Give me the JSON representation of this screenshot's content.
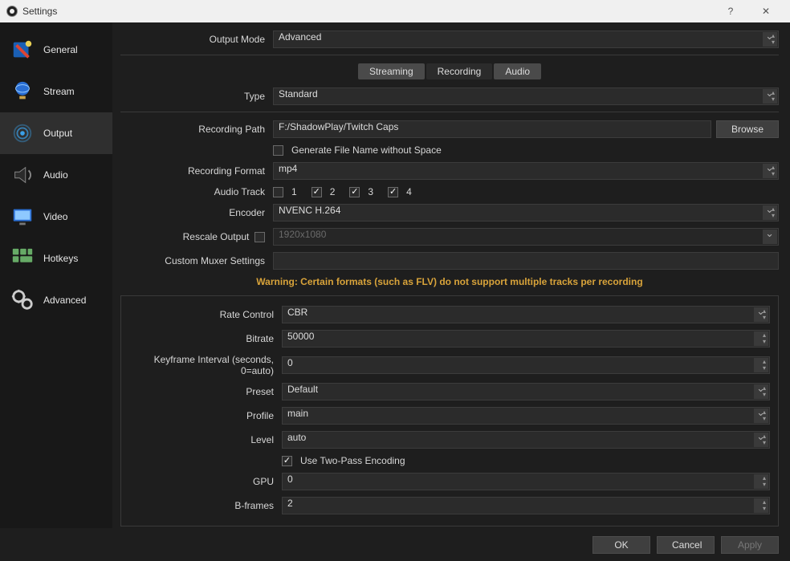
{
  "window": {
    "title": "Settings"
  },
  "sidebar": {
    "items": [
      {
        "label": "General"
      },
      {
        "label": "Stream"
      },
      {
        "label": "Output"
      },
      {
        "label": "Audio"
      },
      {
        "label": "Video"
      },
      {
        "label": "Hotkeys"
      },
      {
        "label": "Advanced"
      }
    ],
    "activeIndex": 2
  },
  "outputMode": {
    "label": "Output Mode",
    "value": "Advanced"
  },
  "tabs": {
    "items": [
      "Streaming",
      "Recording",
      "Audio"
    ],
    "activeIndex": 1
  },
  "recording": {
    "type": {
      "label": "Type",
      "value": "Standard"
    },
    "path": {
      "label": "Recording Path",
      "value": "F:/ShadowPlay/Twitch Caps",
      "browse": "Browse"
    },
    "genNoSpace": {
      "label": "Generate File Name without Space",
      "checked": false
    },
    "format": {
      "label": "Recording Format",
      "value": "mp4"
    },
    "audioTrack": {
      "label": "Audio Track",
      "tracks": [
        {
          "n": "1",
          "on": false
        },
        {
          "n": "2",
          "on": true
        },
        {
          "n": "3",
          "on": true
        },
        {
          "n": "4",
          "on": true
        }
      ]
    },
    "encoder": {
      "label": "Encoder",
      "value": "NVENC H.264"
    },
    "rescale": {
      "label": "Rescale Output",
      "checked": false,
      "value": "1920x1080"
    },
    "muxer": {
      "label": "Custom Muxer Settings",
      "value": ""
    },
    "warning": "Warning: Certain formats (such as FLV) do not support multiple tracks per recording"
  },
  "encoder": {
    "rateControl": {
      "label": "Rate Control",
      "value": "CBR"
    },
    "bitrate": {
      "label": "Bitrate",
      "value": "50000"
    },
    "keyframe": {
      "label": "Keyframe Interval (seconds, 0=auto)",
      "value": "0"
    },
    "preset": {
      "label": "Preset",
      "value": "Default"
    },
    "profile": {
      "label": "Profile",
      "value": "main"
    },
    "level": {
      "label": "Level",
      "value": "auto"
    },
    "twoPass": {
      "label": "Use Two-Pass Encoding",
      "checked": true
    },
    "gpu": {
      "label": "GPU",
      "value": "0"
    },
    "bframes": {
      "label": "B-frames",
      "value": "2"
    }
  },
  "footer": {
    "ok": "OK",
    "cancel": "Cancel",
    "apply": "Apply"
  }
}
